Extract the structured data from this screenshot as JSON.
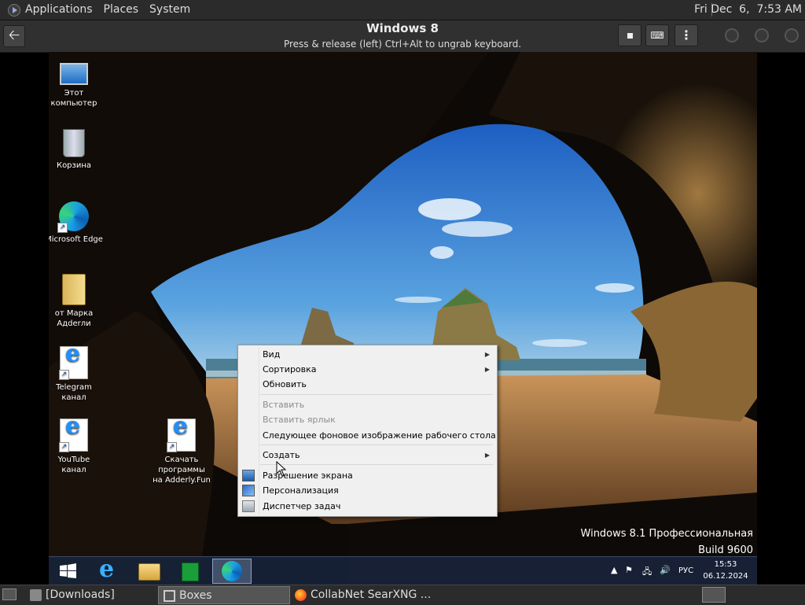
{
  "host_panel": {
    "menu": [
      "Applications",
      "Places",
      "System"
    ],
    "clock": "Fri Dec  6,  7:53 AM"
  },
  "boxes": {
    "title": "Windows 8",
    "subtitle": "Press & release (left) Ctrl+Alt to ungrab keyboard.",
    "back_icon": "back-arrow-icon",
    "toolbar_icons": [
      "stop-icon",
      "keyboard-icon",
      "menu-icon"
    ]
  },
  "desktop_icons": [
    {
      "label": "Этот компьютер",
      "icon": "computer-icon"
    },
    {
      "label": "Корзина",
      "icon": "recycle-bin-icon"
    },
    {
      "label": "Microsoft Edge",
      "icon": "edge-icon"
    },
    {
      "label": "от Марка Адderли",
      "icon": "folder-icon"
    },
    {
      "label": "Telegram канал",
      "icon": "ie-shortcut-icon"
    },
    {
      "label": "YouTube канал",
      "icon": "ie-shortcut-icon"
    },
    {
      "label": "Скачать программы на Adderly.Fun",
      "icon": "ie-shortcut-icon"
    }
  ],
  "context_menu": {
    "view": "Вид",
    "sort": "Сортировка",
    "refresh": "Обновить",
    "paste": "Вставить",
    "paste_shortcut": "Вставить ярлык",
    "next_wallpaper": "Следующее фоновое изображение рабочего стола",
    "create": "Создать",
    "screen_resolution": "Разрешение экрана",
    "personalization": "Персонализация",
    "task_manager": "Диспетчер задач"
  },
  "edition": {
    "line1": "Windows 8.1 Профессиональная",
    "line2": "Build 9600"
  },
  "taskbar": {
    "pinned_icons": [
      "windows-logo-icon",
      "internet-explorer-icon",
      "file-explorer-icon",
      "store-icon",
      "edge-icon"
    ],
    "language": "РУС",
    "time": "15:53",
    "date": "06.12.2024"
  },
  "bottom_panel": {
    "tasks": [
      "[Downloads]",
      "Boxes",
      "CollabNet SearXNG ..."
    ]
  },
  "colors": {
    "guest_taskbar": "#18223a",
    "menu_bg": "#f0f0f0",
    "host_panel": "#2b2b2b"
  }
}
